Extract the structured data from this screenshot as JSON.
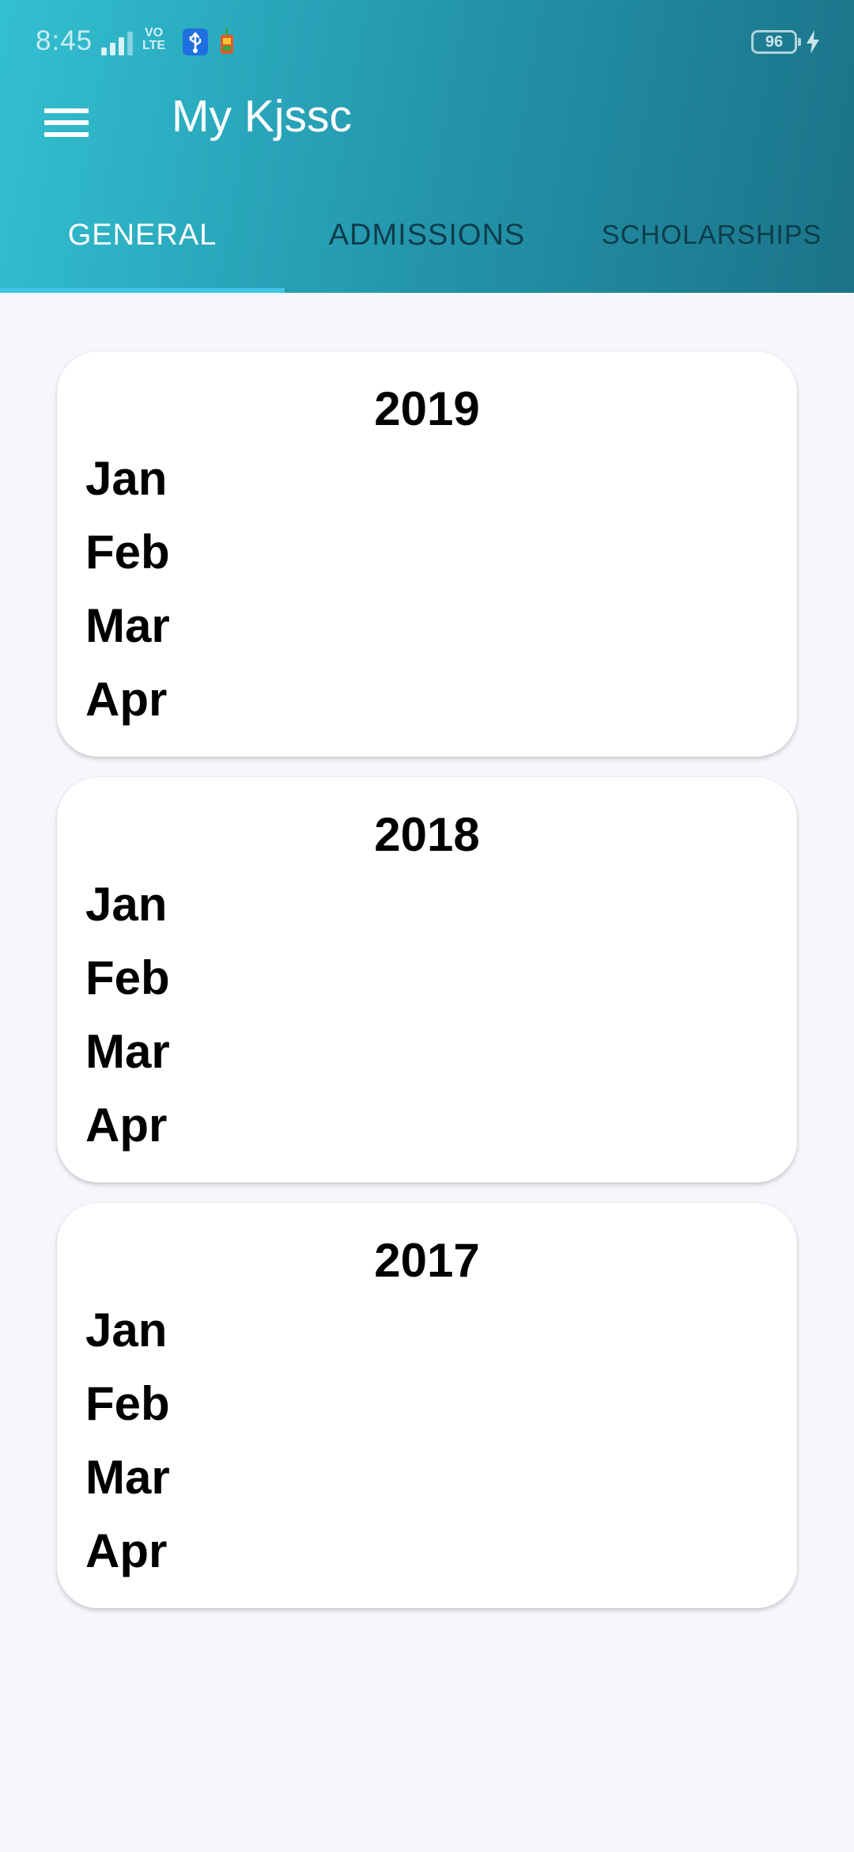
{
  "status_bar": {
    "time": "8:45",
    "network": "VO\nLTE",
    "battery": "96",
    "icons": [
      "signal-icon",
      "volte-icon",
      "usb-debug-icon",
      "app-notification-icon",
      "battery-icon",
      "charging-icon"
    ]
  },
  "app_bar": {
    "title": "My Kjssc",
    "menu_icon": "hamburger-menu-icon"
  },
  "tabs": [
    {
      "label": "GENERAL",
      "active": true
    },
    {
      "label": "ADMISSIONS",
      "active": false
    },
    {
      "label": "SCHOLARSHIPS",
      "active": false
    }
  ],
  "cards": [
    {
      "year": "2019",
      "months": [
        "Jan",
        "Feb",
        "Mar",
        "Apr"
      ]
    },
    {
      "year": "2018",
      "months": [
        "Jan",
        "Feb",
        "Mar",
        "Apr"
      ]
    },
    {
      "year": "2017",
      "months": [
        "Jan",
        "Feb",
        "Mar",
        "Apr"
      ]
    }
  ],
  "colors": {
    "header_gradient_start": "#33c0d1",
    "header_gradient_end": "#1b7388",
    "tab_indicator": "#42c4e6",
    "background": "#f5f7fc",
    "card": "#ffffff"
  }
}
